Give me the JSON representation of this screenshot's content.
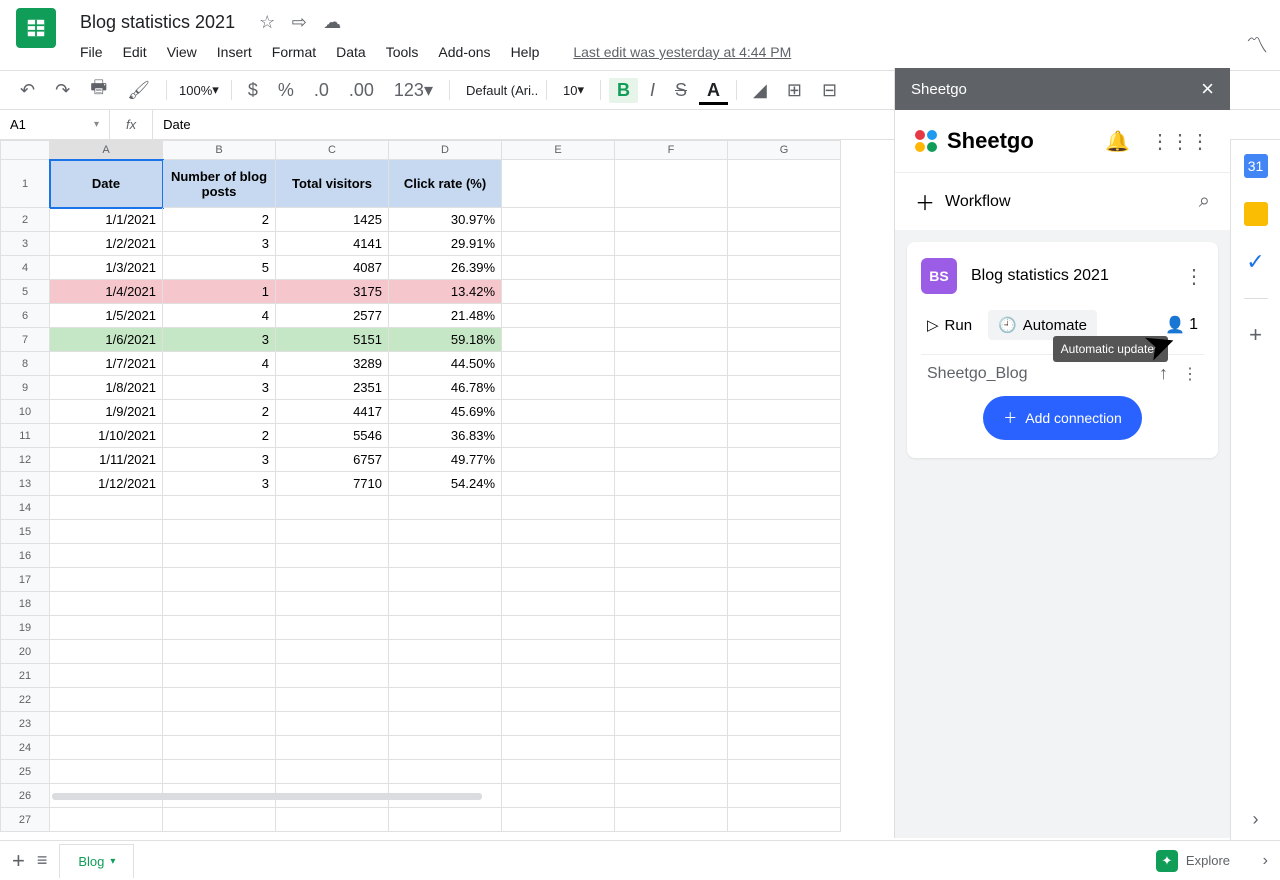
{
  "doc_title": "Blog statistics 2021",
  "last_edit": "Last edit was yesterday at 4:44 PM",
  "menu": [
    "File",
    "Edit",
    "View",
    "Insert",
    "Format",
    "Data",
    "Tools",
    "Add-ons",
    "Help"
  ],
  "toolbar": {
    "zoom": "100%",
    "font": "Default (Ari...",
    "font_size": "10",
    "number_fmt": "123"
  },
  "formula_bar": {
    "name_box": "A1",
    "value": "Date"
  },
  "columns": [
    "A",
    "B",
    "C",
    "D",
    "E",
    "F",
    "G"
  ],
  "headers": [
    "Date",
    "Number of blog posts",
    "Total visitors",
    "Click rate (%)"
  ],
  "rows": [
    {
      "date": "1/1/2021",
      "posts": "2",
      "visitors": "1425",
      "rate": "30.97%",
      "style": ""
    },
    {
      "date": "1/2/2021",
      "posts": "3",
      "visitors": "4141",
      "rate": "29.91%",
      "style": ""
    },
    {
      "date": "1/3/2021",
      "posts": "5",
      "visitors": "4087",
      "rate": "26.39%",
      "style": ""
    },
    {
      "date": "1/4/2021",
      "posts": "1",
      "visitors": "3175",
      "rate": "13.42%",
      "style": "red"
    },
    {
      "date": "1/5/2021",
      "posts": "4",
      "visitors": "2577",
      "rate": "21.48%",
      "style": ""
    },
    {
      "date": "1/6/2021",
      "posts": "3",
      "visitors": "5151",
      "rate": "59.18%",
      "style": "green"
    },
    {
      "date": "1/7/2021",
      "posts": "4",
      "visitors": "3289",
      "rate": "44.50%",
      "style": ""
    },
    {
      "date": "1/8/2021",
      "posts": "3",
      "visitors": "2351",
      "rate": "46.78%",
      "style": ""
    },
    {
      "date": "1/9/2021",
      "posts": "2",
      "visitors": "4417",
      "rate": "45.69%",
      "style": ""
    },
    {
      "date": "1/10/2021",
      "posts": "2",
      "visitors": "5546",
      "rate": "36.83%",
      "style": ""
    },
    {
      "date": "1/11/2021",
      "posts": "3",
      "visitors": "6757",
      "rate": "49.77%",
      "style": ""
    },
    {
      "date": "1/12/2021",
      "posts": "3",
      "visitors": "7710",
      "rate": "54.24%",
      "style": ""
    }
  ],
  "empty_row_count": 14,
  "sheetgo": {
    "title": "Sheetgo",
    "brand": "Sheetgo",
    "workflow_label": "Workflow",
    "card_badge": "BS",
    "card_title": "Blog statistics 2021",
    "run": "Run",
    "automate": "Automate",
    "people": "1",
    "tooltip": "Automatic updates",
    "connection": "Sheetgo_Blog",
    "add_conn": "Add connection"
  },
  "bottom": {
    "sheet_name": "Blog",
    "explore": "Explore"
  }
}
